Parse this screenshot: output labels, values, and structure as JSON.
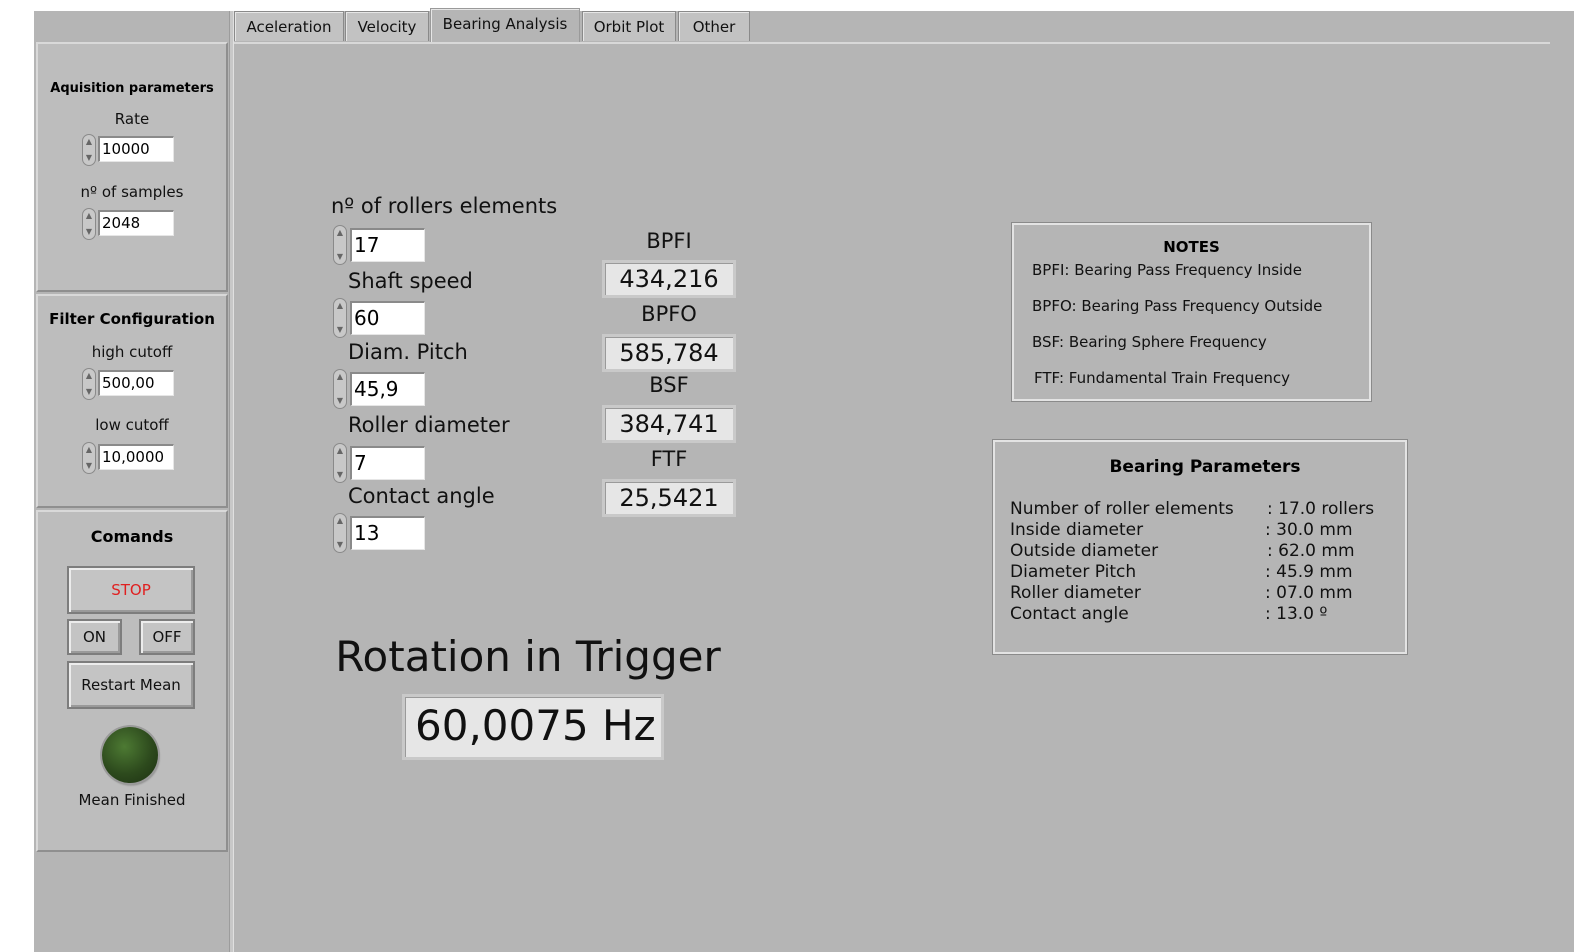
{
  "tabs": [
    {
      "label": "Aceleration"
    },
    {
      "label": "Velocity"
    },
    {
      "label": "Bearing Analysis"
    },
    {
      "label": "Orbit Plot"
    },
    {
      "label": "Other"
    }
  ],
  "active_tab": "Bearing Analysis",
  "acquisition": {
    "title": "Aquisition parameters",
    "rate_label": "Rate",
    "rate_value": "10000",
    "samples_label": "nº of samples",
    "samples_value": "2048"
  },
  "filter": {
    "title": "Filter Configuration",
    "high_label": "high cutoff",
    "high_value": "500,00",
    "low_label": "low cutoff",
    "low_value": "10,0000"
  },
  "commands": {
    "title": "Comands",
    "stop_label": "STOP",
    "on_label": "ON",
    "off_label": "OFF",
    "restart_label": "Restart Mean",
    "led_label": "Mean Finished",
    "stop_color": "#e02020",
    "led_color": "#2d4a1d"
  },
  "bearing_inputs": {
    "rollers_label": "nº of rollers elements",
    "rollers_value": "17",
    "shaft_label": "Shaft speed",
    "shaft_value": "60",
    "pitch_label": "Diam. Pitch",
    "pitch_value": "45,9",
    "roller_diam_label": "Roller diameter",
    "roller_diam_value": "7",
    "contact_label": "Contact angle",
    "contact_value": "13"
  },
  "frequencies": {
    "bpfi_label": "BPFI",
    "bpfi_value": "434,216",
    "bpfo_label": "BPFO",
    "bpfo_value": "585,784",
    "bsf_label": "BSF",
    "bsf_value": "384,741",
    "ftf_label": "FTF",
    "ftf_value": "25,5421"
  },
  "rotation": {
    "title": "Rotation in Trigger",
    "value": "60,0075 Hz"
  },
  "notes": {
    "title": "NOTES",
    "lines": [
      "BPFI: Bearing Pass Frequency Inside",
      "BPFO: Bearing Pass Frequency Outside",
      "BSF: Bearing Sphere Frequency",
      "FTF: Fundamental Train Frequency"
    ]
  },
  "bearing_parameters": {
    "title": "Bearing Parameters",
    "rows": [
      {
        "name": "Number of roller elements",
        "value": ": 17.0 rollers"
      },
      {
        "name": "Inside diameter",
        "value": ": 30.0 mm"
      },
      {
        "name": "Outside diameter",
        "value": ": 62.0 mm"
      },
      {
        "name": "Diameter Pitch",
        "value": ": 45.9 mm"
      },
      {
        "name": "Roller diameter",
        "value": ": 07.0 mm"
      },
      {
        "name": "Contact angle",
        "value": ": 13.0 º"
      }
    ]
  }
}
